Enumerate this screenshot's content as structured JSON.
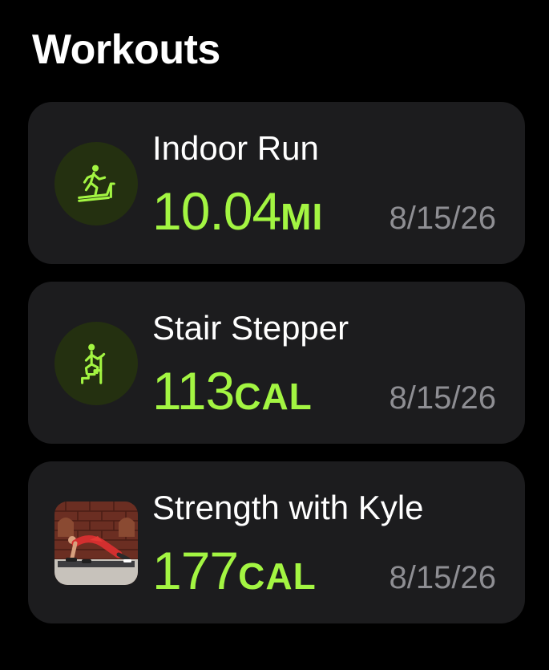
{
  "header": {
    "title": "Workouts"
  },
  "theme": {
    "accent": "#a3f542",
    "card_bg": "#1c1c1e",
    "secondary_text": "#8e8e93"
  },
  "workouts": [
    {
      "name": "Indoor Run",
      "value": "10.04",
      "unit": "MI",
      "date": "8/15/26",
      "icon": "indoor-run-icon"
    },
    {
      "name": "Stair Stepper",
      "value": "113",
      "unit": "CAL",
      "date": "8/15/26",
      "icon": "stair-stepper-icon"
    },
    {
      "name": "Strength with Kyle",
      "value": "177",
      "unit": "CAL",
      "date": "8/15/26",
      "icon": "strength-video-thumbnail"
    }
  ]
}
